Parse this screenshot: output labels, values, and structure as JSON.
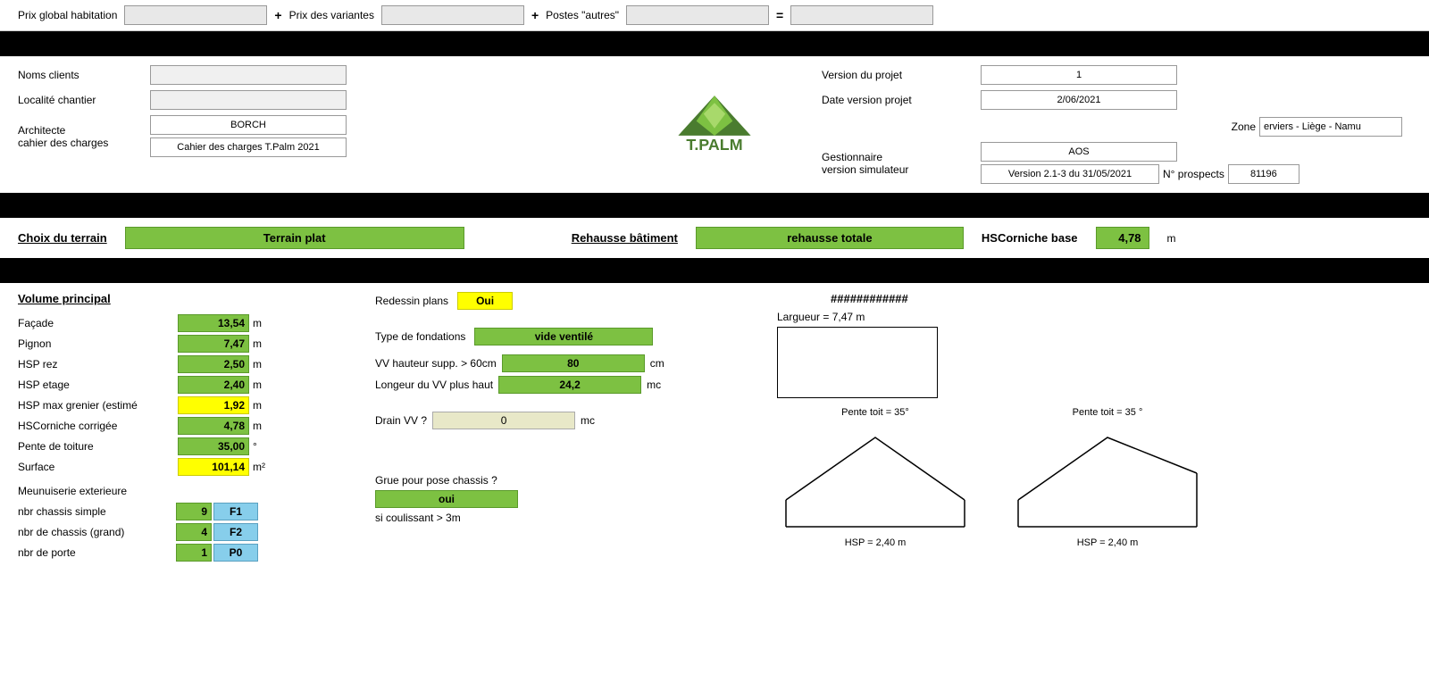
{
  "priceHeader": {
    "label_global": "Prix global habitation",
    "input_global": "",
    "operator1": "+",
    "label_variantes": "Prix des variantes",
    "input_variantes": "",
    "operator2": "+",
    "label_autres": "Postes \"autres\"",
    "input_autres": "",
    "equals": "=",
    "input_total": ""
  },
  "infoSection": {
    "noms_clients_label": "Noms clients",
    "noms_clients_val": "",
    "localite_label": "Localité chantier",
    "localite_val": "",
    "architecte_label": "Architecte\ncahier des charges",
    "architecte_val": "BORCH",
    "cahier_val": "Cahier des charges T.Palm 2021",
    "version_projet_label": "Version du projet",
    "version_projet_val": "1",
    "date_version_label": "Date version projet",
    "date_version_val": "2/06/2021",
    "zone_label": "Zone",
    "zone_val": "erviers - Liège - Namu",
    "gestionnaire_label": "Gestionnaire\nversion simulateur",
    "gestionnaire_val": "AOS",
    "version_sim_val": "Version 2.1-3 du 31/05/2021",
    "prospects_label": "N° prospects",
    "prospects_val": "81196"
  },
  "terrain": {
    "choix_label": "Choix du terrain",
    "terrain_val": "Terrain plat",
    "rehausse_label": "Rehausse bâtiment",
    "rehausse_val": "rehausse totale",
    "hscorniche_label": "HSCorniche base",
    "hscorniche_val": "4,78",
    "hscorniche_unit": "m"
  },
  "volumePrincipal": {
    "title": "Volume principal",
    "rows": [
      {
        "label": "Façade",
        "value": "13,54",
        "unit": "m",
        "color": "green"
      },
      {
        "label": "Pignon",
        "value": "7,47",
        "unit": "m",
        "color": "green"
      },
      {
        "label": "HSP rez",
        "value": "2,50",
        "unit": "m",
        "color": "green"
      },
      {
        "label": "HSP etage",
        "value": "2,40",
        "unit": "m",
        "color": "green"
      },
      {
        "label": "HSP max grenier (estimé",
        "value": "1,92",
        "unit": "m",
        "color": "yellow"
      },
      {
        "label": "HSCorniche corrigée",
        "value": "4,78",
        "unit": "m",
        "color": "green"
      },
      {
        "label": "Pente de toiture",
        "value": "35,00",
        "unit": "°",
        "color": "green"
      },
      {
        "label": "Surface",
        "value": "101,14",
        "unit": "m²",
        "color": "yellow"
      }
    ]
  },
  "menuiserie": {
    "label": "Meunuiserie exterieure",
    "chassis": [
      {
        "label": "nbr chassis simple",
        "value": "9",
        "tag": "F1"
      },
      {
        "label": "nbr de chassis (grand)",
        "value": "4",
        "tag": "F2"
      },
      {
        "label": "nbr de porte",
        "value": "1",
        "tag": "P0"
      }
    ]
  },
  "redessin": {
    "label": "Redessin plans",
    "value": "Oui"
  },
  "fondations": {
    "label": "Type de fondations",
    "value": "vide ventilé"
  },
  "vv": [
    {
      "label": "VV hauteur supp. > 60cm",
      "value": "80",
      "unit": "cm"
    },
    {
      "label": "Longeur du VV plus haut",
      "value": "24,2",
      "unit": "mc"
    }
  ],
  "drain": {
    "label": "Drain VV ?",
    "value": "0",
    "unit": "mc"
  },
  "grue": {
    "label": "Grue pour pose chassis ?",
    "value": "oui"
  },
  "coulissant": {
    "label": "si coulissant > 3m"
  },
  "diagrams": {
    "hash_label": "############",
    "largueur_label": "Largueur = 7,47 m",
    "left": {
      "pente_label": "Pente toit = 35°",
      "hsp_label": "HSP = 2,40 m"
    },
    "right": {
      "pente_label": "Pente toit = 35 °",
      "hsp_label": "HSP = 2,40 m"
    }
  }
}
